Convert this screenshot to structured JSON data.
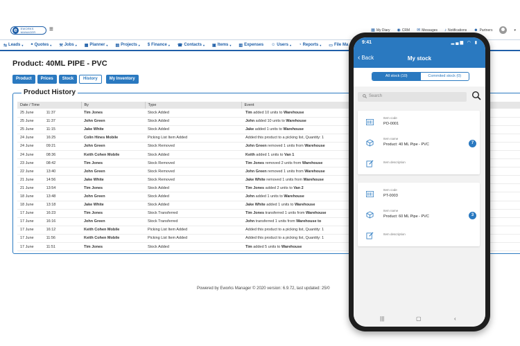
{
  "app": {
    "logo_text": "EWORKS MANAGER",
    "util": [
      {
        "icon": "calendar-icon",
        "label": "My Diary"
      },
      {
        "icon": "crm-icon",
        "label": "CRM"
      },
      {
        "icon": "message-icon",
        "label": "Messages"
      },
      {
        "icon": "bell-icon",
        "label": "Notifications"
      },
      {
        "icon": "partners-icon",
        "label": "Partners"
      }
    ],
    "nav": [
      {
        "icon": "leads-icon",
        "label": "Leads",
        "dropdown": true
      },
      {
        "icon": "quotes-icon",
        "label": "Quotes",
        "dropdown": true
      },
      {
        "icon": "jobs-icon",
        "label": "Jobs",
        "dropdown": true
      },
      {
        "icon": "planner-icon",
        "label": "Planner",
        "dropdown": true
      },
      {
        "icon": "projects-icon",
        "label": "Projects",
        "dropdown": true
      },
      {
        "icon": "finance-icon",
        "label": "Finance",
        "dropdown": true
      },
      {
        "icon": "contacts-icon",
        "label": "Contacts",
        "dropdown": true
      },
      {
        "icon": "items-icon",
        "label": "Items",
        "dropdown": true
      },
      {
        "icon": "expenses-icon",
        "label": "Expenses",
        "dropdown": false
      },
      {
        "icon": "users-icon",
        "label": "Users",
        "dropdown": true
      },
      {
        "icon": "reports-icon",
        "label": "Reports",
        "dropdown": true
      },
      {
        "icon": "file-icon",
        "label": "File Ma",
        "dropdown": false
      }
    ]
  },
  "product": {
    "title": "Product: 40ML PIPE - PVC",
    "tabs": [
      "Product",
      "Prices",
      "Stock",
      "History"
    ],
    "active_tab": "History",
    "my_inventory": "My Inventory"
  },
  "history": {
    "title": "Product History",
    "columns": [
      "Date / Time",
      "By",
      "Type",
      "Event"
    ],
    "rows": [
      {
        "date": "25 June",
        "time": "11:37",
        "by": "Tim Jones",
        "type": "Stock Added",
        "event_pre": "",
        "event_b1": "Tim",
        "event_mid": " added 10 units to ",
        "event_b2": "Warehouse",
        "extra": "ecorded for PO"
      },
      {
        "date": "25 June",
        "time": "11:37",
        "by": "John Green",
        "type": "Stock Added",
        "event_pre": "",
        "event_b1": "John",
        "event_mid": " added 10 units to ",
        "event_b2": "Warehouse",
        "extra": "ecorded for PO"
      },
      {
        "date": "25 June",
        "time": "11:15",
        "by": "Jake White",
        "type": "Stock Added",
        "event_pre": "",
        "event_b1": "Jake",
        "event_mid": " added 1 units to ",
        "event_b2": "Warehouse",
        "extra": "st: Stock picked"
      },
      {
        "date": "24 June",
        "time": "16:25",
        "by": "Colin Hines Mobile",
        "type": "Picking List Item Added",
        "event_pre": "Added this product to a picking list, Quantity: 1",
        "event_b1": "",
        "event_mid": "",
        "event_b2": "",
        "extra": "ecorded for PO"
      },
      {
        "date": "24 June",
        "time": "09:21",
        "by": "John Green",
        "type": "Stock Removed",
        "event_pre": "",
        "event_b1": "John Green",
        "event_mid": " removed 1 units from ",
        "event_b2": "Warehouse",
        "extra": "d for job JOB-0"
      },
      {
        "date": "24 June",
        "time": "08:36",
        "by": "Keith Cohen Mobile",
        "type": "Stock Added",
        "event_pre": "",
        "event_b1": "Keith",
        "event_mid": " added 1 units to ",
        "event_b2": "Van 1",
        "extra": "ecorded for PO"
      },
      {
        "date": "23 June",
        "time": "08:42",
        "by": "Tim Jones",
        "type": "Stock Removed",
        "event_pre": "",
        "event_b1": "Tim Jones",
        "event_mid": " removed 2 units from ",
        "event_b2": "Warehouse",
        "extra": "d for job JOB-0"
      },
      {
        "date": "22 June",
        "time": "13:40",
        "by": "John Green",
        "type": "Stock Removed",
        "event_pre": "",
        "event_b1": "John Green",
        "event_mid": " removed 1 units from ",
        "event_b2": "Warehouse",
        "extra": "d for job JOB-0"
      },
      {
        "date": "21 June",
        "time": "14:56",
        "by": "Jake White",
        "type": "Stock Removed",
        "event_pre": "",
        "event_b1": "Jake White",
        "event_mid": " removed 1 units from ",
        "event_b2": "Warehouse",
        "extra": "many"
      },
      {
        "date": "21 June",
        "time": "13:54",
        "by": "Tim Jones",
        "type": "Stock Added",
        "event_pre": "",
        "event_b1": "Tim Jones",
        "event_mid": " added 2 units to ",
        "event_b2": "Van 2",
        "extra": ""
      },
      {
        "date": "18 June",
        "time": "13:48",
        "by": "John Green",
        "type": "Stock Added",
        "event_pre": "",
        "event_b1": "John",
        "event_mid": " added 1 units to ",
        "event_b2": "Warehouse",
        "extra": "st: Stock receiv"
      },
      {
        "date": "18 June",
        "time": "13:18",
        "by": "Jake White",
        "type": "Stock Added",
        "event_pre": "",
        "event_b1": "Jake White",
        "event_mid": " added 1 units to ",
        "event_b2": "Warehouse",
        "extra": ""
      },
      {
        "date": "17 June",
        "time": "16:23",
        "by": "Tim Jones",
        "type": "Stock Transferred",
        "event_pre": "",
        "event_b1": "Tim Jones",
        "event_mid": " transferred 1 units from ",
        "event_b2": "Warehouse",
        "extra": ""
      },
      {
        "date": "17 June",
        "time": "16:16",
        "by": "John Green",
        "type": "Stock Transferred",
        "event_pre": "",
        "event_b1": "John",
        "event_mid": " transferred 1 units from ",
        "event_b2": "Warehouse to",
        "extra": ""
      },
      {
        "date": "17 June",
        "time": "16:12",
        "by": "Keith Cohen Mobile",
        "type": "Picking List Item Added",
        "event_pre": "Added this product to a picking list, Quantity: 1",
        "event_b1": "",
        "event_mid": "",
        "event_b2": "",
        "extra": ""
      },
      {
        "date": "17 June",
        "time": "11:56",
        "by": "Keith Cohen Mobile",
        "type": "Picking List Item Added",
        "event_pre": "Added this product to a picking list, Quantity: 1",
        "event_b1": "",
        "event_mid": "",
        "event_b2": "",
        "extra": ""
      },
      {
        "date": "17 June",
        "time": "11:51",
        "by": "Tim Jones",
        "type": "Stock Added",
        "event_pre": "",
        "event_b1": "Tim",
        "event_mid": " added 5 units to ",
        "event_b2": "Warehouse",
        "extra": "ck by Roxy"
      }
    ]
  },
  "footer": "Powered by Eworks Manager © 2020 version: 6.9.72, last updated: 25/0",
  "mobile": {
    "time": "9:41",
    "back": "Back",
    "title": "My stock",
    "segments": [
      "All stock (10)",
      "Commited stock (0)"
    ],
    "active_segment": 0,
    "search_placeholder": "Search",
    "cards": [
      {
        "code_label": "Item code",
        "code": "PO-0001",
        "name_label": "Item name",
        "name": "Product: 40 ML Pipe - PVC",
        "badge": "7",
        "desc_label": "Item description"
      },
      {
        "code_label": "Item code",
        "code": "PT-0003",
        "name_label": "Item name",
        "name": "Product: 60 ML Pipe - PVC",
        "badge": "3",
        "desc_label": "Item description"
      }
    ]
  },
  "colors": {
    "accent": "#2a79c0",
    "brand": "#1f5fa8"
  }
}
